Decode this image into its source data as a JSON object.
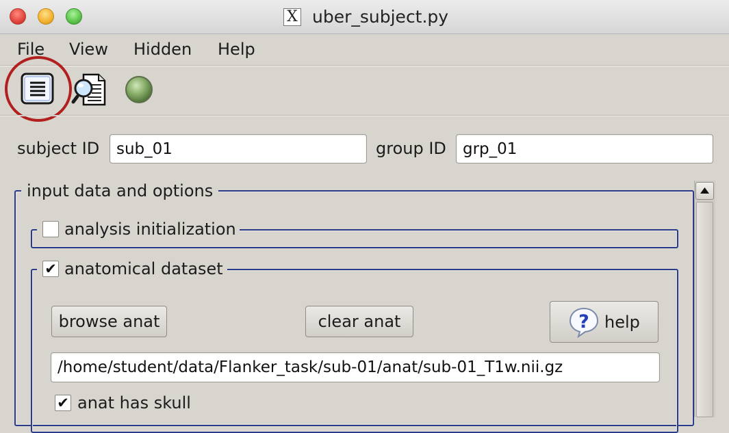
{
  "window": {
    "title": "uber_subject.py"
  },
  "menubar": {
    "items": [
      {
        "label": "File"
      },
      {
        "label": "View"
      },
      {
        "label": "Hidden"
      },
      {
        "label": "Help"
      }
    ]
  },
  "toolbar": {
    "icons": [
      "document-list-icon",
      "document-search-icon",
      "green-status-light-icon"
    ]
  },
  "subject": {
    "subject_id_label": "subject ID",
    "subject_id_value": "sub_01",
    "group_id_label": "group ID",
    "group_id_value": "grp_01"
  },
  "input_section": {
    "title": "input data and options",
    "analysis_init": {
      "label": "analysis initialization",
      "checked": false
    },
    "anatomical": {
      "label": "anatomical dataset",
      "checked": true,
      "browse_label": "browse anat",
      "clear_label": "clear anat",
      "help_label": "help",
      "path_value": "/home/student/data/Flanker_task/sub-01/anat/sub-01_T1w.nii.gz",
      "skull_label": "anat has skull",
      "skull_checked": true
    }
  },
  "colors": {
    "background": "#d8d5cf",
    "group_border": "#2a3b8a",
    "highlight_circle": "#b1201e"
  }
}
